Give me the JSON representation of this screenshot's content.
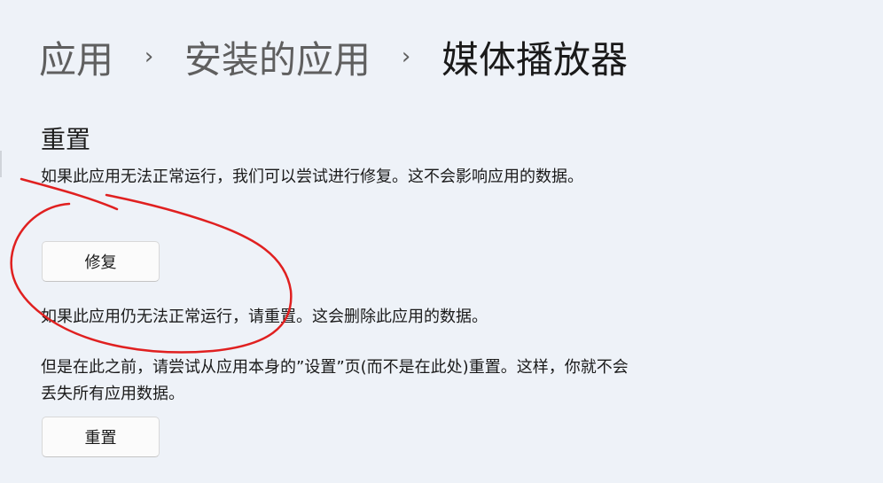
{
  "breadcrumb": {
    "item1": "应用",
    "item2": "安装的应用",
    "current": "媒体播放器",
    "separator": "›"
  },
  "reset_section": {
    "title": "重置",
    "repair_description": "如果此应用无法正常运行，我们可以尝试进行修复。这不会影响应用的数据。",
    "repair_button": "修复",
    "reset_description": "如果此应用仍无法正常运行，请重置。这会删除此应用的数据。",
    "reset_note": "但是在此之前，请尝试从应用本身的”设置”页(而不是在此处)重置。这样，你就不会丢失所有应用数据。",
    "reset_button": "重置"
  },
  "annotation_color": "#e02020"
}
